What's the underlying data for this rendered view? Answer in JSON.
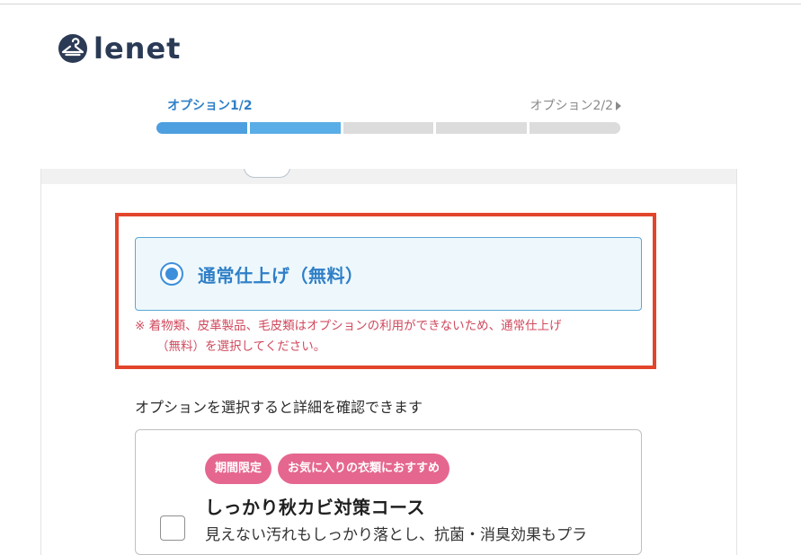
{
  "brand": {
    "name": "lenet",
    "icon": "hanger-logo-icon",
    "color": "#2b3a55"
  },
  "steps": {
    "current": "オプション1/2",
    "next": "オプション2/2",
    "next_icon": "caret-right-icon",
    "progress_fraction": 0.4,
    "segment_count": 5,
    "active_segments": 2
  },
  "standard_option": {
    "label": "通常仕上げ（無料）",
    "selected": true,
    "note_line1": "※ 着物類、皮革製品、毛皮類はオプションの利用ができないため、通常仕上げ",
    "note_line2": "（無料）を選択してください。"
  },
  "hint": "オプションを選択すると詳細を確認できます",
  "course_option": {
    "badges": [
      "期間限定",
      "お気に入りの衣類におすすめ"
    ],
    "title": "しっかり秋カビ対策コース",
    "description": "見えない汚れもしっかり落とし、抗菌・消臭効果もプラ",
    "checked": false
  },
  "colors": {
    "accent_blue": "#2f7fc7",
    "highlight_red": "#e2452b",
    "note_red": "#d04a5e",
    "badge_pink": "#e5678f"
  }
}
